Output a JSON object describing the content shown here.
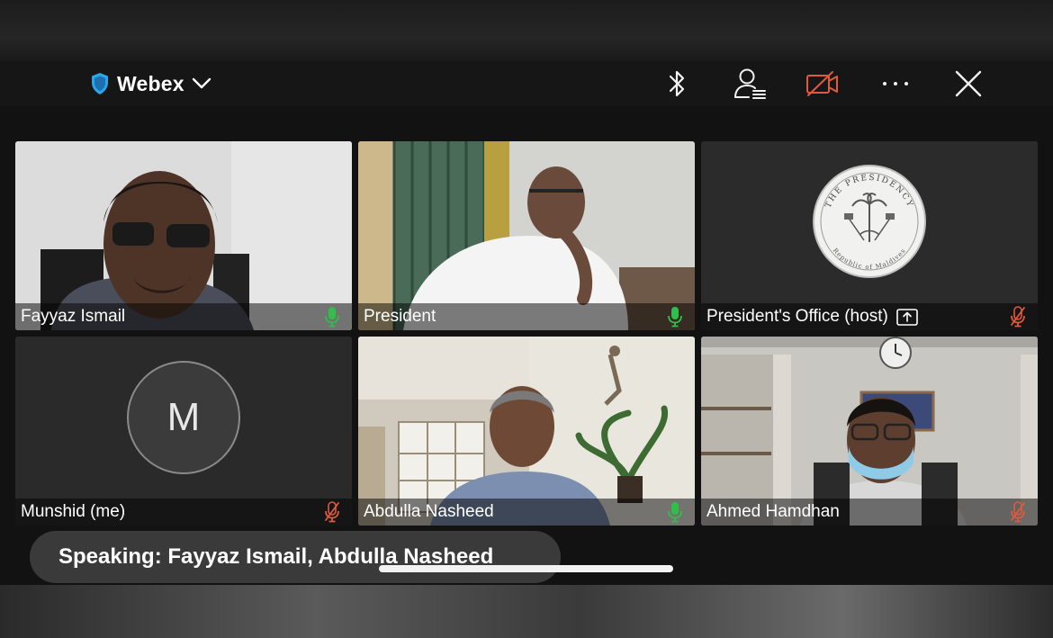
{
  "app": {
    "title": "Webex"
  },
  "toolbar": {
    "icons": [
      "bluetooth-icon",
      "participants-icon",
      "video-off-icon",
      "more-icon",
      "close-icon"
    ],
    "colors": {
      "video_off": "#e05a3c",
      "shield": "#2aa7e8"
    }
  },
  "participants": [
    {
      "name": "Fayyaz Ismail",
      "mic": "on",
      "active_speaker": true
    },
    {
      "name": "President",
      "mic": "on"
    },
    {
      "name": "President's Office (host)",
      "mic": "muted",
      "sharing": true
    },
    {
      "name": "Munshid (me)",
      "mic": "muted",
      "avatar_initial": "M"
    },
    {
      "name": "Abdulla Nasheed",
      "mic": "on"
    },
    {
      "name": "Ahmed Hamdhan",
      "mic": "muted"
    }
  ],
  "seal": {
    "top_text": "THE PRESIDENCY",
    "bottom_text": "Republic of Maldives"
  },
  "speaking_banner": {
    "text": "Speaking: Fayyaz Ismail, Abdulla Nasheed"
  },
  "colors": {
    "mic_on": "#2fbf4a",
    "mic_muted": "#e05a3c",
    "active_border": "#1d9bd7"
  }
}
